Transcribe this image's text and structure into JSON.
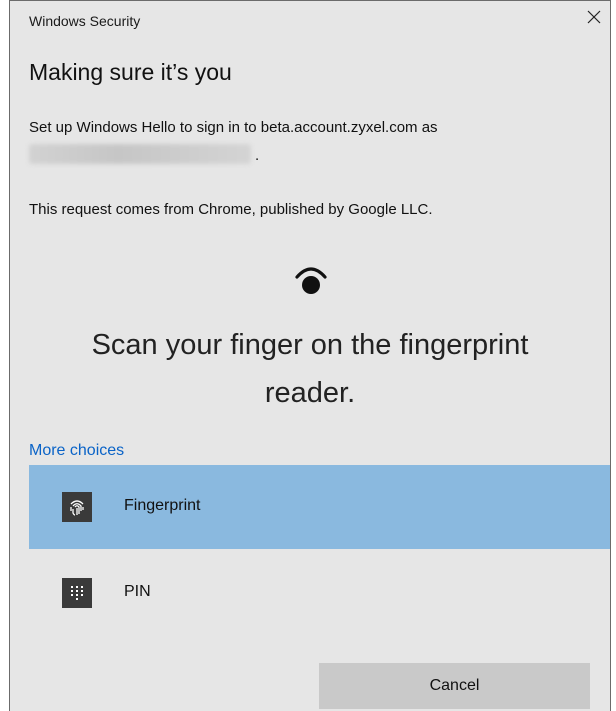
{
  "window": {
    "title": "Windows Security",
    "close_glyph": "×"
  },
  "dialog": {
    "heading": "Making sure it’s you",
    "setup_text": "Set up Windows Hello to sign in to beta.account.zyxel.com as",
    "setup_text_end": ".",
    "request_text": "This request comes from Chrome, published by Google LLC.",
    "scan_line1": "Scan your finger on the fingerprint",
    "scan_line2": "reader."
  },
  "choices": {
    "more_label": "More choices",
    "options": [
      {
        "label": "Fingerprint",
        "icon": "fingerprint-icon",
        "selected": true
      },
      {
        "label": "PIN",
        "icon": "pin-keypad-icon",
        "selected": false
      }
    ]
  },
  "buttons": {
    "cancel_label": "Cancel"
  },
  "colors": {
    "dialog_bg": "#e6e6e6",
    "selected_bg": "#8ab9df",
    "link": "#0a63c7",
    "button_bg": "#c9c9c9"
  }
}
